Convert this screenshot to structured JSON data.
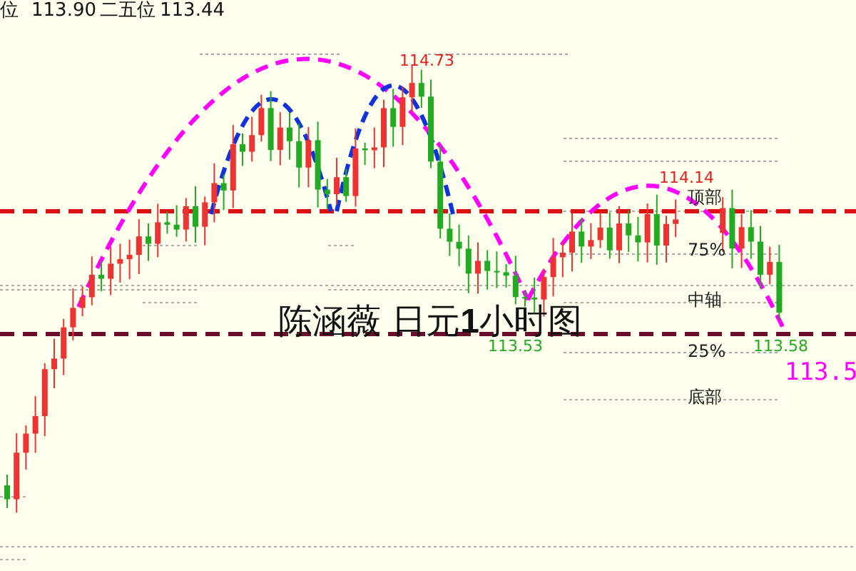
{
  "header": [
    {
      "label": "位",
      "value": "113.90"
    },
    {
      "label": "二五位",
      "value": "113.44"
    }
  ],
  "title": "陈涵薇 日元**1**小时图",
  "levels": [
    "顶部",
    "75%",
    "中轴",
    "25%",
    "底部"
  ],
  "price_labels": [
    {
      "text": "114.73",
      "kind": "high"
    },
    {
      "text": "114.14",
      "kind": "high"
    },
    {
      "text": "113.53",
      "kind": "low"
    },
    {
      "text": "113.58",
      "kind": "low"
    },
    {
      "text": "113.5",
      "kind": "target"
    }
  ]
}
